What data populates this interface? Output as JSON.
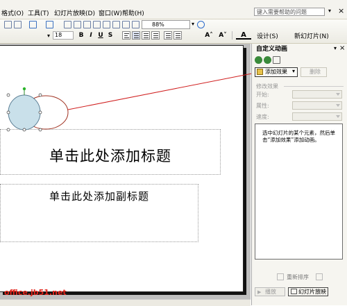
{
  "menubar": {
    "items": [
      "格式(O)",
      "工具(T)",
      "幻灯片放映(D)",
      "窗口(W)",
      "帮助(H)"
    ],
    "help_search_placeholder": "键入需要帮助的问题",
    "close_glyph": "×"
  },
  "toolbar": {
    "font_size": "18",
    "bold_label": "B",
    "italic_label": "I",
    "underline_label": "U",
    "shadow_label": "S",
    "zoom": "88%",
    "increase_font_label": "A˄",
    "decrease_font_label": "A˅",
    "design_label": "设计(S)",
    "new_slide_label": "新幻灯片(N)"
  },
  "slide": {
    "title_placeholder": "单击此处添加标题",
    "subtitle_placeholder": "单击此处添加副标题"
  },
  "task_pane": {
    "title": "自定义动画",
    "close_glyph": "×",
    "add_effect_label": "添加效果",
    "remove_label": "删除",
    "modify_heading": "修改效果",
    "start_label": "开始:",
    "property_label": "属性:",
    "speed_label": "速度:",
    "list_message": "选中幻灯片的某个元素，然后单击“添加效果”添加动画。",
    "reorder_label": "重新排序",
    "play_label": "播放",
    "slideshow_label": "幻灯片放映"
  },
  "watermark": "office.jb51.net",
  "colors": {
    "accent_arrow": "#d01f1f",
    "oval_fill": "#c9e0ea",
    "oval_outline": "#a0301f",
    "watermark": "#e2231a"
  }
}
